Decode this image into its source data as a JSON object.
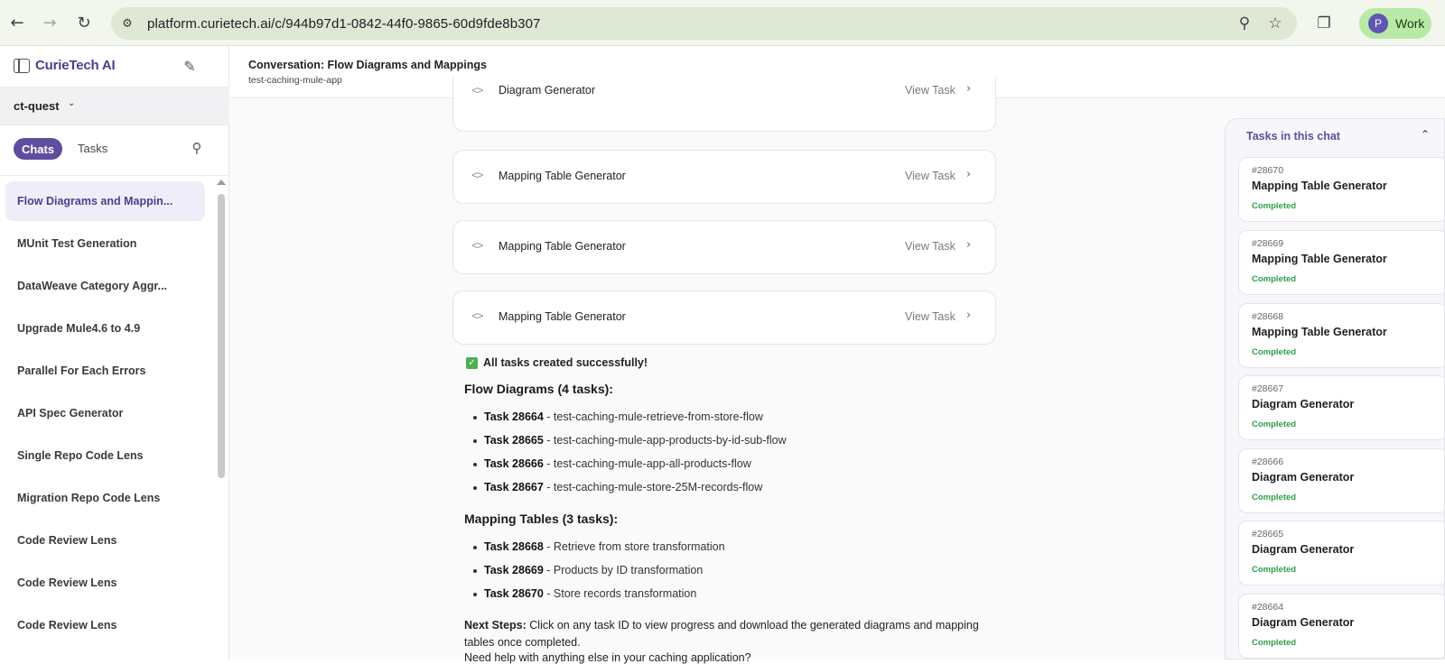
{
  "browser": {
    "url": "platform.curietech.ai/c/944b97d1-0842-44f0-9865-60d9fde8b307",
    "profile_initial": "P",
    "profile_label": "Work"
  },
  "sidebar": {
    "brand": "CurieTech AI",
    "workspace": "ct-quest",
    "tabs": [
      "Chats",
      "Tasks"
    ],
    "chats": [
      "Flow Diagrams and Mappin...",
      "MUnit Test Generation",
      "DataWeave Category Aggr...",
      "Upgrade Mule4.6 to 4.9",
      "Parallel For Each Errors",
      "API Spec Generator",
      "Single Repo Code Lens",
      "Migration Repo Code Lens",
      "Code Review Lens",
      "Code Review Lens",
      "Code Review Lens"
    ]
  },
  "conversation": {
    "title": "Conversation: Flow Diagrams and Mappings",
    "subtitle": "test-caching-mule-app",
    "view_task_label": "View Task",
    "cards": [
      "Diagram Generator",
      "Mapping Table Generator",
      "Mapping Table Generator",
      "Mapping Table Generator"
    ],
    "success_text": "All tasks created successfully!",
    "flow_heading": "Flow Diagrams (4 tasks):",
    "flow_tasks": [
      {
        "id": "Task 28664",
        "desc": "test-caching-mule-retrieve-from-store-flow"
      },
      {
        "id": "Task 28665",
        "desc": "test-caching-mule-app-products-by-id-sub-flow"
      },
      {
        "id": "Task 28666",
        "desc": "test-caching-mule-app-all-products-flow"
      },
      {
        "id": "Task 28667",
        "desc": "test-caching-mule-store-25M-records-flow"
      }
    ],
    "mapping_heading": "Mapping Tables (3 tasks):",
    "mapping_tasks": [
      {
        "id": "Task 28668",
        "desc": "Retrieve from store transformation"
      },
      {
        "id": "Task 28669",
        "desc": "Products by ID transformation"
      },
      {
        "id": "Task 28670",
        "desc": "Store records transformation"
      }
    ],
    "next_steps_label": "Next Steps:",
    "next_steps_text": "Click on any task ID to view progress and download the generated diagrams and mapping tables once completed.",
    "help_text": "Need help with anything else in your caching application?",
    "task_separator": " - "
  },
  "tasks_panel": {
    "title": "Tasks in this chat",
    "tasks": [
      {
        "id": "#28670",
        "name": "Mapping Table Generator",
        "status": "Completed"
      },
      {
        "id": "#28669",
        "name": "Mapping Table Generator",
        "status": "Completed"
      },
      {
        "id": "#28668",
        "name": "Mapping Table Generator",
        "status": "Completed"
      },
      {
        "id": "#28667",
        "name": "Diagram Generator",
        "status": "Completed"
      },
      {
        "id": "#28666",
        "name": "Diagram Generator",
        "status": "Completed"
      },
      {
        "id": "#28665",
        "name": "Diagram Generator",
        "status": "Completed"
      },
      {
        "id": "#28664",
        "name": "Diagram Generator",
        "status": "Completed"
      }
    ]
  },
  "colors": {
    "brand": "#4b3f8c",
    "accent": "#5f4e9d",
    "status_completed": "#2e9e48"
  }
}
